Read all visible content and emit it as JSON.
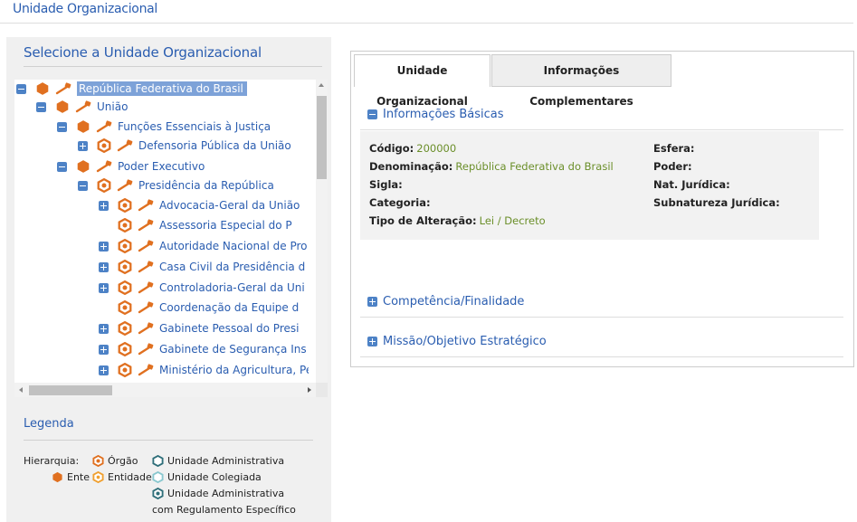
{
  "page": {
    "title": "Unidade Organizacional"
  },
  "tree": {
    "heading": "Selecione a Unidade Organizacional",
    "items": [
      {
        "label": "República Federativa do Brasil",
        "toggle": "minus",
        "icon": "ente"
      },
      {
        "label": "União",
        "toggle": "minus",
        "icon": "ente"
      },
      {
        "label": "Funções Essenciais à Justiça",
        "toggle": "minus",
        "icon": "ente"
      },
      {
        "label": "Defensoria Pública da União",
        "toggle": "plus",
        "icon": "orgao"
      },
      {
        "label": "Poder Executivo",
        "toggle": "minus",
        "icon": "ente"
      },
      {
        "label": "Presidência da República",
        "toggle": "minus",
        "icon": "orgao"
      },
      {
        "label": "Advocacia-Geral da União",
        "toggle": "plus",
        "icon": "orgao"
      },
      {
        "label": "Assessoria Especial do P",
        "toggle": "none",
        "icon": "orgao"
      },
      {
        "label": "Autoridade Nacional de Pro",
        "toggle": "plus",
        "icon": "orgao"
      },
      {
        "label": "Casa Civil da Presidência d",
        "toggle": "plus",
        "icon": "orgao"
      },
      {
        "label": "Controladoria-Geral da Uni",
        "toggle": "plus",
        "icon": "orgao"
      },
      {
        "label": "Coordenação da Equipe d",
        "toggle": "none",
        "icon": "orgao"
      },
      {
        "label": "Gabinete Pessoal do Presi",
        "toggle": "plus",
        "icon": "orgao"
      },
      {
        "label": "Gabinete de Segurança Ins",
        "toggle": "plus",
        "icon": "orgao"
      },
      {
        "label": "Ministério da Agricultura, Pe",
        "toggle": "plus",
        "icon": "orgao"
      }
    ]
  },
  "legend": {
    "title": "Legenda",
    "hierarquia": "Hierarquia:",
    "orgao": "Órgão",
    "ente": "Ente",
    "entidade": "Entidade",
    "unidade_administrativa": "Unidade Administrativa",
    "unidade_colegiada": "Unidade Colegiada",
    "unidade_admin_reg_line1": "Unidade Administrativa",
    "unidade_admin_reg_line2": "com Regulamento Específico"
  },
  "tabs": [
    {
      "label": "Unidade Organizacional",
      "active": true
    },
    {
      "label": "Informações Complementares",
      "active": false
    }
  ],
  "sections": {
    "basic": "Informações Básicas",
    "competencia": "Competência/Finalidade",
    "missao": "Missão/Objetivo Estratégico"
  },
  "fields": {
    "codigo_label": "Código:",
    "codigo_value": "200000",
    "denominacao_label": "Denominação:",
    "denominacao_value": "República Federativa do Brasil",
    "sigla_label": "Sigla:",
    "categoria_label": "Categoria:",
    "tipo_alteracao_label": "Tipo de Alteração:",
    "tipo_alteracao_value": "Lei / Decreto",
    "esfera_label": "Esfera:",
    "poder_label": "Poder:",
    "nat_juridica_label": "Nat. Jurídica:",
    "subnatureza_label": "Subnatureza Jurídica:"
  },
  "colors": {
    "accent": "#2a5db0",
    "icon_orange": "#e07020",
    "value_green": "#6b8f2a",
    "toggle_blue": "#4d82c6",
    "selected_bg": "#7da2d8"
  }
}
